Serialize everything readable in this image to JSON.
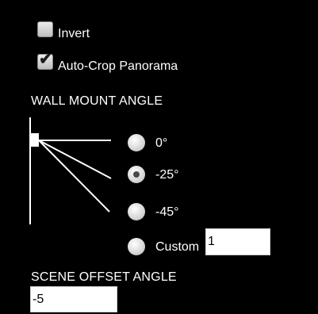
{
  "invert": {
    "label": "Invert",
    "checked": false
  },
  "auto_crop": {
    "label": "Auto-Crop Panorama",
    "checked": true,
    "check_glyph": "✔"
  },
  "wall_mount": {
    "heading": "WALL MOUNT ANGLE",
    "options": [
      {
        "label": "0°",
        "selected": false
      },
      {
        "label": "-25°",
        "selected": true
      },
      {
        "label": "-45°",
        "selected": false
      },
      {
        "label": "Custom",
        "selected": false
      }
    ],
    "custom_value": "1"
  },
  "scene_offset": {
    "heading": "SCENE OFFSET ANGLE",
    "value": "-5"
  },
  "colors": {
    "background": "#000000",
    "text": "#ffffff"
  }
}
